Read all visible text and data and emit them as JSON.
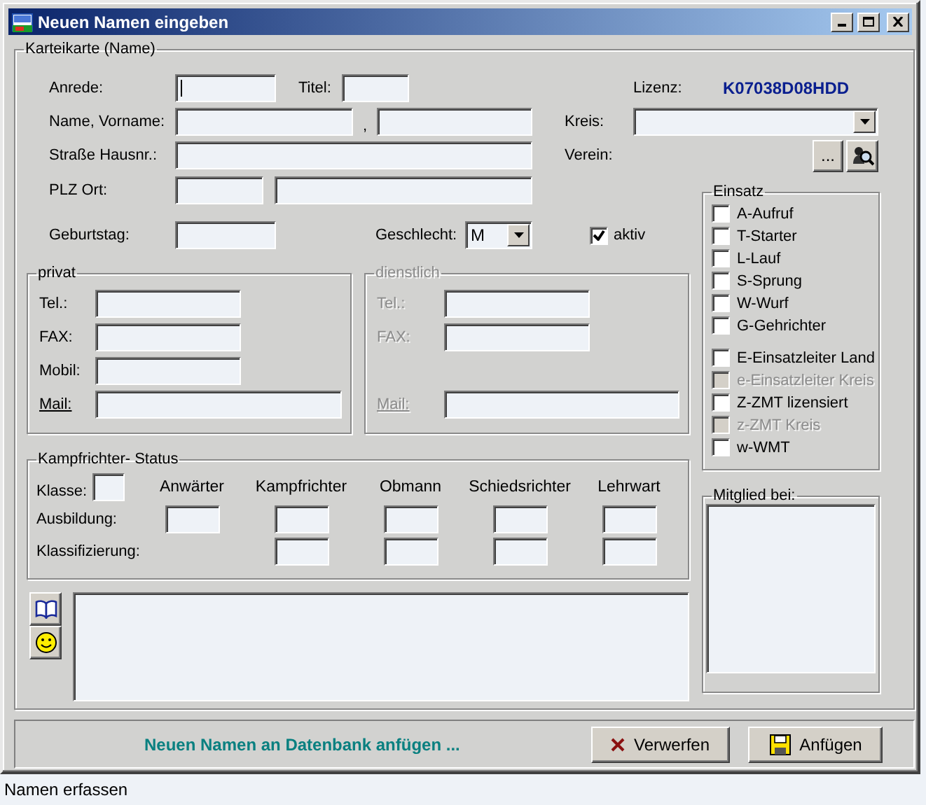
{
  "window": {
    "title": "Neuen Namen eingeben"
  },
  "card": {
    "legend": "Karteikarte (Name)",
    "anrede_label": "Anrede:",
    "anrede_focused": true,
    "titel_label": "Titel:",
    "lizenz": {
      "label": "Lizenz:",
      "value": "K07038D08HDD"
    },
    "name_label": "Name, Vorname:",
    "name_separator": ",",
    "kreis_label": "Kreis:",
    "strasse_label": "Straße Hausnr.:",
    "verein_label": "Verein:",
    "verein_browse": "...",
    "plz_label": "PLZ Ort:",
    "geburtstag_label": "Geburtstag:",
    "geschlecht": {
      "label": "Geschlecht:",
      "value": "M"
    },
    "aktiv": {
      "label": "aktiv",
      "checked": true
    }
  },
  "contacts": [
    {
      "legend": "privat",
      "disabled": false,
      "fields": [
        {
          "label": "Tel.:",
          "kind": "short"
        },
        {
          "label": "FAX:",
          "kind": "short"
        },
        {
          "label": "Mobil:",
          "kind": "short"
        },
        {
          "label": "Mail:",
          "kind": "mail"
        }
      ]
    },
    {
      "legend": "dienstlich",
      "disabled": true,
      "fields": [
        {
          "label": "Tel.:",
          "kind": "short"
        },
        {
          "label": "FAX:",
          "kind": "short"
        },
        {
          "label": "Mail:",
          "kind": "mail"
        }
      ]
    }
  ],
  "referee": {
    "legend": "Kampfrichter- Status",
    "klasse_label": "Klasse:",
    "ausbildung_label": "Ausbildung:",
    "klassifizierung_label": "Klassifizierung:",
    "columns": [
      {
        "label": "Anwärter",
        "kind": "single"
      },
      {
        "label": "Kampfrichter",
        "kind": "double"
      },
      {
        "label": "Obmann",
        "kind": "double"
      },
      {
        "label": "Schiedsrichter",
        "kind": "double"
      },
      {
        "label": "Lehrwart",
        "kind": "double"
      }
    ]
  },
  "einsatz": {
    "legend": "Einsatz",
    "groups": [
      [
        {
          "label": "A-Aufruf",
          "checked": false,
          "disabled": false
        },
        {
          "label": "T-Starter",
          "checked": false,
          "disabled": false
        },
        {
          "label": "L-Lauf",
          "checked": false,
          "disabled": false
        },
        {
          "label": "S-Sprung",
          "checked": false,
          "disabled": false
        },
        {
          "label": "W-Wurf",
          "checked": false,
          "disabled": false
        },
        {
          "label": "G-Gehrichter",
          "checked": false,
          "disabled": false
        }
      ],
      [
        {
          "label": "E-Einsatzleiter Land",
          "checked": false,
          "disabled": false
        },
        {
          "label": "e-Einsatzleiter Kreis",
          "checked": false,
          "disabled": true
        },
        {
          "label": "Z-ZMT lizensiert",
          "checked": false,
          "disabled": false
        },
        {
          "label": "z-ZMT Kreis",
          "checked": false,
          "disabled": true
        },
        {
          "label": "w-WMT",
          "checked": false,
          "disabled": false
        }
      ]
    ]
  },
  "mitglied": {
    "legend": "Mitglied bei:"
  },
  "footer": {
    "message": "Neuen Namen an Datenbank anfügen ...",
    "buttons": [
      {
        "label": "Verwerfen",
        "kind": "discard"
      },
      {
        "label": "Anfügen",
        "kind": "save"
      }
    ]
  },
  "status_bar": "Namen erfassen"
}
